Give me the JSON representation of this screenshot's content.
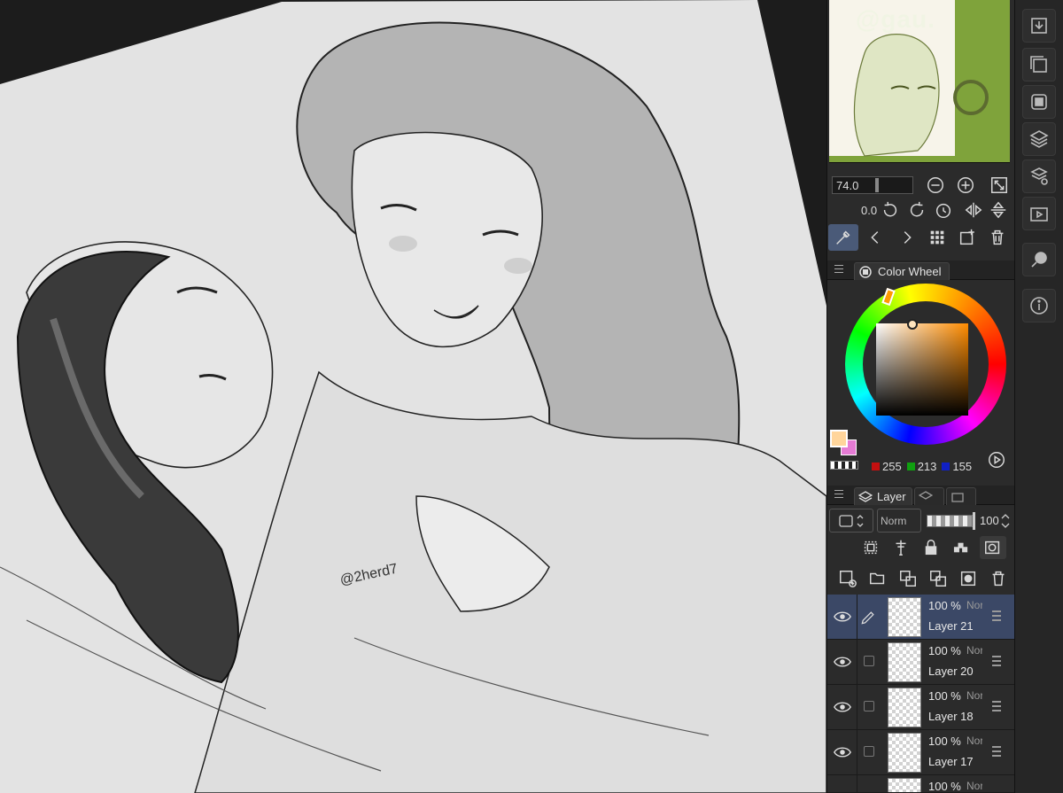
{
  "navigator": {
    "watermark": "@gau."
  },
  "zoom": {
    "value": "74.0",
    "rotation": "0.0"
  },
  "color_panel": {
    "tab_label": "Color Wheel",
    "main_color": "#ffd59b",
    "sub_color": "#e57bd4",
    "red": "255",
    "green": "213",
    "blue": "155"
  },
  "layer_panel": {
    "tab_label": "Layer",
    "blend_mode": "Norm",
    "opacity": "100",
    "layers": [
      {
        "opacity": "100 %",
        "blend": "Nor",
        "name": "Layer 21"
      },
      {
        "opacity": "100 %",
        "blend": "Nor",
        "name": "Layer 20"
      },
      {
        "opacity": "100 %",
        "blend": "Nor",
        "name": "Layer 18"
      },
      {
        "opacity": "100 %",
        "blend": "Nor",
        "name": "Layer 17"
      },
      {
        "opacity": "100 %",
        "blend": "Nor",
        "name": ""
      }
    ]
  },
  "artwork": {
    "signature": "@2herd7"
  },
  "colors": {
    "panel_bg": "#2b2b2b",
    "selected_layer": "#3b4866",
    "active_tool": "#4a5a78"
  }
}
